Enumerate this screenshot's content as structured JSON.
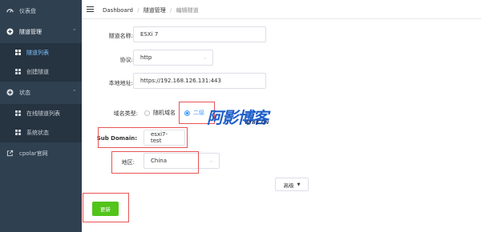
{
  "sidebar": {
    "items": [
      {
        "label": "仪表盘"
      },
      {
        "label": "隧道管理"
      },
      {
        "label": "隧道列表"
      },
      {
        "label": "创建隧道"
      },
      {
        "label": "状态"
      },
      {
        "label": "在线隧道列表"
      },
      {
        "label": "系统状态"
      },
      {
        "label": "cpolar官网"
      }
    ],
    "bg_color": "#2f4050",
    "sub_bg_color": "#263340"
  },
  "breadcrumb": {
    "items": [
      "Dashboard",
      "隧道管理",
      "编辑隧道"
    ]
  },
  "form": {
    "tunnel_name_label": "隧道名称:",
    "tunnel_name_value": "ESXi 7",
    "protocol_label": "协议:",
    "protocol_value": "http",
    "local_address_label": "本地地址:",
    "local_address_value": "https://192.168.126.131:443",
    "domain_type_label": "域名类型:",
    "domain_type_options": [
      "随机域名",
      "二级"
    ],
    "subdomain_label": "Sub Domain:",
    "subdomain_value": "esxi7-test",
    "region_label": "地区:",
    "region_value": "China",
    "advanced_label": "高级",
    "update_button": "更新"
  },
  "watermark": {
    "main": "阿影博客",
    "sub": "AYBK.CN"
  },
  "colors": {
    "accent": "#409eff",
    "highlight_border": "#e85454",
    "update_button": "#52c41a"
  }
}
